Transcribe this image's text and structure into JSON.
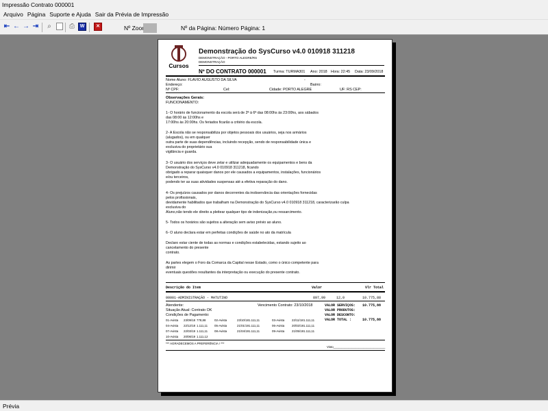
{
  "window": {
    "title": "Impressão Contrato 000001"
  },
  "menu": [
    "Arquivo",
    "Página",
    "Suporte e Ajuda",
    "Sair da Prévia de Impressão"
  ],
  "toolbar": {
    "zoom_label": "Nº Zoom",
    "page_info": "Nº da Página: Número Página: 1",
    "icons": [
      "first-page-icon",
      "prev-page-icon",
      "next-page-icon",
      "last-page-icon",
      "zoom-icon",
      "page-icon",
      "print-icon",
      "save-icon",
      "close-icon"
    ]
  },
  "document": {
    "logo_text": "Cursos",
    "title": "Demonstração do SysCurso v4.0 010918 311218",
    "subtitle1": "DEMONSTRAÇÃO - PORTO ALEGRE/RS",
    "subtitle2": "DEMONSTRAÇÃO",
    "contract_label": "Nº DO CONTRATO 000001",
    "turma": "Turma: TURMA301",
    "ano": "Ano: 2018",
    "hora": "Hora: 22:45",
    "data": "Data: 23/09/2018",
    "aluno": "Nome Aluno: FLAVIO AUGUSTO DA SILVA",
    "dash": "-",
    "endereco": "Endereço:",
    "bairro": "Bairro:",
    "cpf": "Nº CPF:",
    "cel": "Cel:",
    "cidade": "Cidade: PORTO ALEGRE",
    "uf": "UF: RS CEP:",
    "obs_title": "Observações Gerais:",
    "obs_sub": "FUNCIONAMENTO:",
    "paragraphs": [
      [
        "1- O horário de funcionamento da escola será de 2ª à 6ª das 08:00hs às 23:00hs, aos sábados",
        "das 08:00 às 12:00hs e",
        "17:00hs às 20:00hs. Os feriados ficarão a critério da escola."
      ],
      [
        "2- A Escola não se responsabiliza por objetos pessoais dos usuários, seja nos armários",
        "(alugados), ou em qualquer",
        "outra parte de suas dependências, incluindo recepção, sendo de responsabilidade única e",
        "exclusiva do proprietário sua",
        "vigilância e guarda."
      ],
      [
        "3- O usuário dos serviços deve zelar e utilizar adequadamente os equipamentos e bens da",
        "Demonstração do SysCurso v4.0 010918 311218, ficando",
        "obrigado a reparar quaisquer danos por ele causados a equipamentos, instalações, funcionários",
        "e/ou terceiros,",
        "podendo ter as suas atividades suspensas até a efetiva reparação do dano."
      ],
      [
        "4- Os prejuízos causados por danos decorrentes da inobservância das orientações fornecidas",
        "pelos profissionais,",
        "devidamente habilitados que trabalham na Demonstração do SysCurso v4.0 010918 311218, caracterizarão culpa",
        "exclusiva do",
        "Aluno,não tendo ele direito a pleitear qualquer tipo de indenização,ou ressarcimento."
      ],
      [
        "5- Todos os horários são sujeitos a alteração sem aviso prévio ao aluno."
      ],
      [
        "6- O aluno declara estar em perfeitas condições de saúde no ato da matrícula"
      ],
      [
        "Declaro estar ciente de todas as normas e condições estabelecidas, estando sujeito ao",
        "cancelamento do presente",
        "contrato."
      ],
      [
        "As partes elegem o Foro da Comarca da Capital nesse Estado, como o único competente para",
        "dirimir",
        "eventuais questões resultantes da interpretação ou execução do presente contrato."
      ]
    ],
    "table": {
      "col_desc": "Descrição do Item",
      "col_valor": "Valor",
      "col_total": "Vlr Total",
      "item_desc": "00001-ADMINISTRAÇÃO - MATUTINO",
      "item_valor": "897,99",
      "item_qtd": "12,0",
      "item_total": "10.775,88"
    },
    "atendente": "Atendente:",
    "situacao": "Situação Atual: Contrato OK",
    "condicoes": "Condições de Pagamento:",
    "vencimento": "Vencimento Contrato: 23/10/2018",
    "parcelas": [
      [
        "01-Avista",
        "23/09/18",
        "778,88",
        "02-Avista",
        "23/10/18",
        "1.111,11",
        "03-Avista",
        "22/11/18",
        "1.111,11"
      ],
      [
        "04-Avista",
        "22/12/18",
        "1.111,11",
        "05-Avista",
        "21/01/19",
        "1.111,11",
        "06-Avista",
        "20/02/19",
        "1.111,11"
      ],
      [
        "07-Avista",
        "22/03/19",
        "1.111,11",
        "08-Avista",
        "21/04/19",
        "1.111,11",
        "09-Avista",
        "21/05/19",
        "1.111,11"
      ],
      [
        "10-Avista",
        "20/06/19",
        "1.111,12"
      ]
    ],
    "totals": [
      [
        "VALOR SERVIÇOS:",
        "10.775,88"
      ],
      [
        "VALOR PRODUTOS:",
        ""
      ],
      [
        "VALOR DESCONTO:",
        ""
      ],
      [
        "VALOR TOTAL   :",
        "10.775,88"
      ]
    ],
    "footer_note": "*** AGRADECEMOS A PREFERÊNCIA ! ***",
    "visto": "Visto_______________________________"
  },
  "status": {
    "text": "Prévia"
  }
}
